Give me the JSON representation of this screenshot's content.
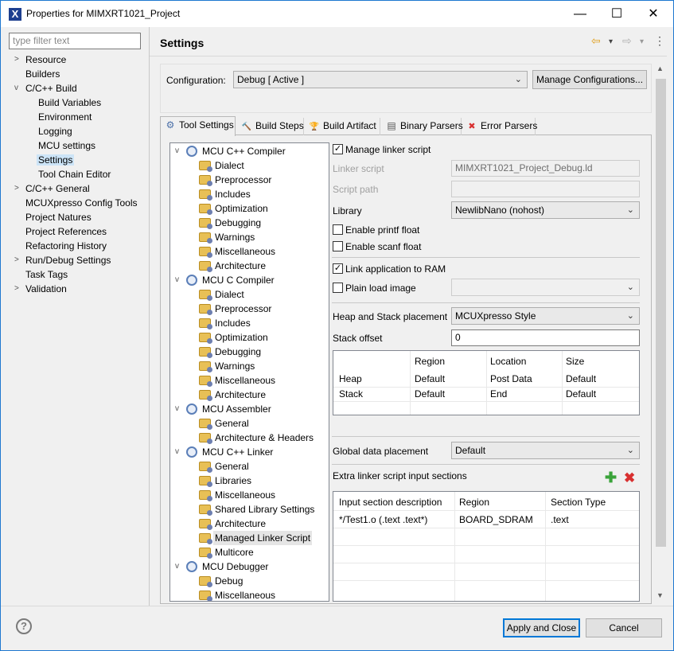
{
  "window": {
    "title": "Properties for MIMXRT1021_Project",
    "app_icon": "X",
    "minimize_icon": "—",
    "maximize_icon": "☐",
    "close_icon": "✕"
  },
  "filter": {
    "placeholder": "type filter text"
  },
  "nav": {
    "items": [
      {
        "label": "Resource",
        "arrow": ">"
      },
      {
        "label": "Builders"
      },
      {
        "label": "C/C++ Build",
        "arrow": "v"
      },
      {
        "label": "Build Variables"
      },
      {
        "label": "Environment"
      },
      {
        "label": "Logging"
      },
      {
        "label": "MCU settings"
      },
      {
        "label": "Settings"
      },
      {
        "label": "Tool Chain Editor"
      },
      {
        "label": "C/C++ General",
        "arrow": ">"
      },
      {
        "label": "MCUXpresso Config Tools"
      },
      {
        "label": "Project Natures"
      },
      {
        "label": "Project References"
      },
      {
        "label": "Refactoring History"
      },
      {
        "label": "Run/Debug Settings",
        "arrow": ">"
      },
      {
        "label": "Task Tags"
      },
      {
        "label": "Validation",
        "arrow": ">"
      }
    ]
  },
  "header": {
    "title": "Settings",
    "back_icon": "⇦",
    "forward_icon": "⇨",
    "dropdown_icon": "▾",
    "menu_icon": "⋮"
  },
  "config": {
    "label": "Configuration:",
    "value": "Debug  [ Active ]",
    "manage_button": "Manage Configurations..."
  },
  "tabs": [
    {
      "label": "Tool Settings",
      "icon": "⚙"
    },
    {
      "label": "Build Steps",
      "icon": "🔨"
    },
    {
      "label": "Build Artifact",
      "icon": "🏆"
    },
    {
      "label": "Binary Parsers",
      "icon": "▤"
    },
    {
      "label": "Error Parsers",
      "icon": "✖"
    }
  ],
  "tools": [
    {
      "label": "MCU C++ Compiler",
      "level": 0
    },
    {
      "label": "Dialect",
      "level": 1
    },
    {
      "label": "Preprocessor",
      "level": 1
    },
    {
      "label": "Includes",
      "level": 1
    },
    {
      "label": "Optimization",
      "level": 1
    },
    {
      "label": "Debugging",
      "level": 1
    },
    {
      "label": "Warnings",
      "level": 1
    },
    {
      "label": "Miscellaneous",
      "level": 1
    },
    {
      "label": "Architecture",
      "level": 1
    },
    {
      "label": "MCU C Compiler",
      "level": 0
    },
    {
      "label": "Dialect",
      "level": 1
    },
    {
      "label": "Preprocessor",
      "level": 1
    },
    {
      "label": "Includes",
      "level": 1
    },
    {
      "label": "Optimization",
      "level": 1
    },
    {
      "label": "Debugging",
      "level": 1
    },
    {
      "label": "Warnings",
      "level": 1
    },
    {
      "label": "Miscellaneous",
      "level": 1
    },
    {
      "label": "Architecture",
      "level": 1
    },
    {
      "label": "MCU Assembler",
      "level": 0
    },
    {
      "label": "General",
      "level": 1
    },
    {
      "label": "Architecture & Headers",
      "level": 1
    },
    {
      "label": "MCU C++ Linker",
      "level": 0
    },
    {
      "label": "General",
      "level": 1
    },
    {
      "label": "Libraries",
      "level": 1
    },
    {
      "label": "Miscellaneous",
      "level": 1
    },
    {
      "label": "Shared Library Settings",
      "level": 1
    },
    {
      "label": "Architecture",
      "level": 1
    },
    {
      "label": "Managed Linker Script",
      "level": 1
    },
    {
      "label": "Multicore",
      "level": 1
    },
    {
      "label": "MCU Debugger",
      "level": 0
    },
    {
      "label": "Debug",
      "level": 1
    },
    {
      "label": "Miscellaneous",
      "level": 1
    }
  ],
  "settings": {
    "manage_linker_script": {
      "label": "Manage linker script",
      "checked": true
    },
    "linker_script": {
      "label": "Linker script",
      "value": "MIMXRT1021_Project_Debug.ld"
    },
    "script_path": {
      "label": "Script path",
      "value": ""
    },
    "library": {
      "label": "Library",
      "value": "NewlibNano (nohost)"
    },
    "printf_float": {
      "label": "Enable printf float",
      "checked": false
    },
    "scanf_float": {
      "label": "Enable scanf float",
      "checked": false
    },
    "link_to_ram": {
      "label": "Link application to RAM",
      "checked": true
    },
    "plain_load": {
      "label": "Plain load image",
      "checked": false
    },
    "heap_stack": {
      "label": "Heap and Stack placement",
      "value": "MCUXpresso Style"
    },
    "stack_offset": {
      "label": "Stack offset",
      "value": "0"
    },
    "heap_table": {
      "headers": [
        "",
        "Region",
        "Location",
        "Size"
      ],
      "rows": [
        [
          "Heap",
          "Default",
          "Post Data",
          "Default"
        ],
        [
          "Stack",
          "Default",
          "End",
          "Default"
        ]
      ]
    },
    "global_data": {
      "label": "Global data placement",
      "value": "Default"
    },
    "extra_sections": {
      "label": "Extra linker script input sections",
      "add_icon": "✚",
      "remove_icon": "✖",
      "headers": [
        "Input section description",
        "Region",
        "Section Type"
      ],
      "rows": [
        [
          "*/Test1.o (.text .text*)",
          "BOARD_SDRAM",
          ".text"
        ]
      ]
    }
  },
  "checkmark": "✓",
  "chevron": "⌄",
  "scroll_up": "▲",
  "scroll_down": "▼",
  "footer": {
    "help_icon": "?",
    "apply_close": "Apply and Close",
    "cancel": "Cancel"
  }
}
